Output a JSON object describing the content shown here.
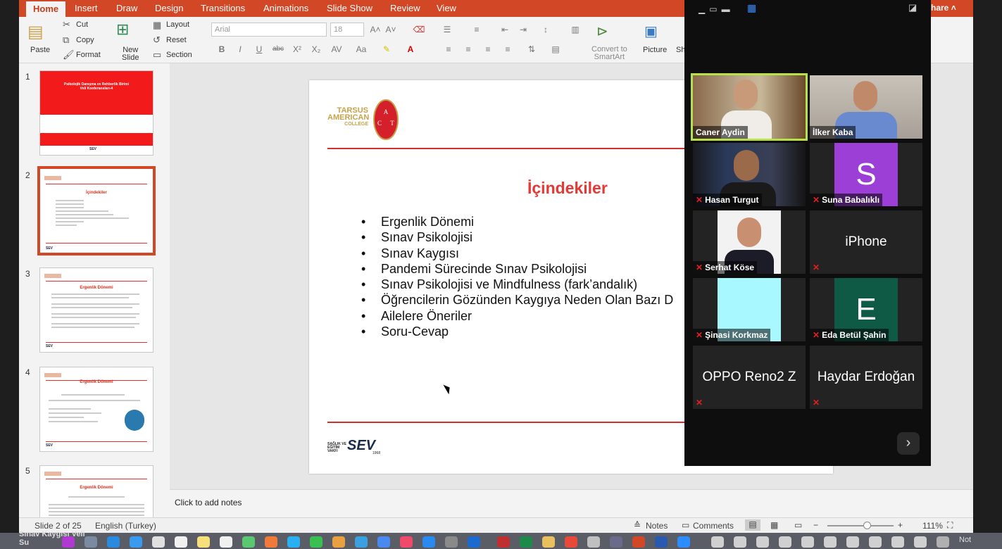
{
  "ribbon": {
    "tabs": [
      "Home",
      "Insert",
      "Draw",
      "Design",
      "Transitions",
      "Animations",
      "Slide Show",
      "Review",
      "View"
    ],
    "active_tab": "Home",
    "paste": "Paste",
    "cut": "Cut",
    "copy": "Copy",
    "format": "Format",
    "new_slide": [
      "New",
      "Slide"
    ],
    "layout": "Layout",
    "reset": "Reset",
    "section": "Section",
    "font_name": "Arial",
    "font_size": "18",
    "convert": [
      "Convert to",
      "SmartArt"
    ],
    "picture": "Picture",
    "sh": "Sh",
    "share": "hare"
  },
  "thumbnails": [
    {
      "num": "1",
      "title": "Psikolojik Danışma ve Rehberlik Birimi Veli Konferansları-4",
      "footer": "SEV"
    },
    {
      "num": "2",
      "title": "İçindekiler",
      "footer": "SEV"
    },
    {
      "num": "3",
      "title": "Ergenlik Dönemi",
      "footer": "SEV"
    },
    {
      "num": "4",
      "title": "Ergenlik Dönemi",
      "footer": "SEV"
    },
    {
      "num": "5",
      "title": "Ergenlik Dönemi",
      "footer": ""
    }
  ],
  "slide": {
    "logo_text": [
      "TARSUS",
      "AMERICAN",
      "COLLEGE"
    ],
    "title": "İçindekiler",
    "bullets": [
      "Ergenlik Dönemi",
      "Sınav Psikolojisi",
      "Sınav Kaygısı",
      "Pandemi Sürecinde Sınav Psikolojisi",
      "Sınav Psikolojisi ve Mindfulness (fark’andalık)",
      "Öğrencilerin Gözünden Kaygıya Neden Olan Bazı D",
      "Ailelere Öneriler",
      "Soru-Cevap"
    ],
    "footer_logo": "SEV",
    "footer_small": [
      "SAĞLIK VE",
      "EĞİTİM",
      "VAKFI"
    ],
    "footer_year": "1968"
  },
  "notes_placeholder": "Click to add notes",
  "status": {
    "slide_info": "Slide 2 of 25",
    "language": "English (Turkey)",
    "notes": "Notes",
    "comments": "Comments",
    "zoom": "111%",
    "zoom_level_pct": 60
  },
  "zoom": {
    "participants": [
      {
        "name": "Caner Aydin",
        "muted": false,
        "type": "video",
        "active": true
      },
      {
        "name": "İlker Kaba",
        "muted": false,
        "type": "video",
        "active": false
      },
      {
        "name": "Hasan Turgut",
        "muted": true,
        "type": "video",
        "active": false
      },
      {
        "name": "Suna Babalıklı",
        "muted": true,
        "type": "avatar",
        "letter": "S",
        "color": "#9b3fd6",
        "active": false
      },
      {
        "name": "Serhat Köse",
        "muted": true,
        "type": "photo",
        "active": false
      },
      {
        "name": "iPhone",
        "muted": true,
        "type": "name",
        "active": false
      },
      {
        "name": "Şinasi Korkmaz",
        "muted": true,
        "type": "cyan",
        "active": false
      },
      {
        "name": "Eda Betül Şahin",
        "muted": true,
        "type": "avatar",
        "letter": "E",
        "color": "#0f5a45",
        "active": false
      },
      {
        "name": "OPPO Reno2 Z",
        "muted": true,
        "type": "name",
        "active": false
      },
      {
        "name": "Haydar Erdoğan",
        "muted": true,
        "type": "name",
        "active": false
      }
    ]
  },
  "dock": {
    "left_text": [
      "Sınav Kaygısı Veli",
      "Su"
    ],
    "right_text": "Not"
  }
}
